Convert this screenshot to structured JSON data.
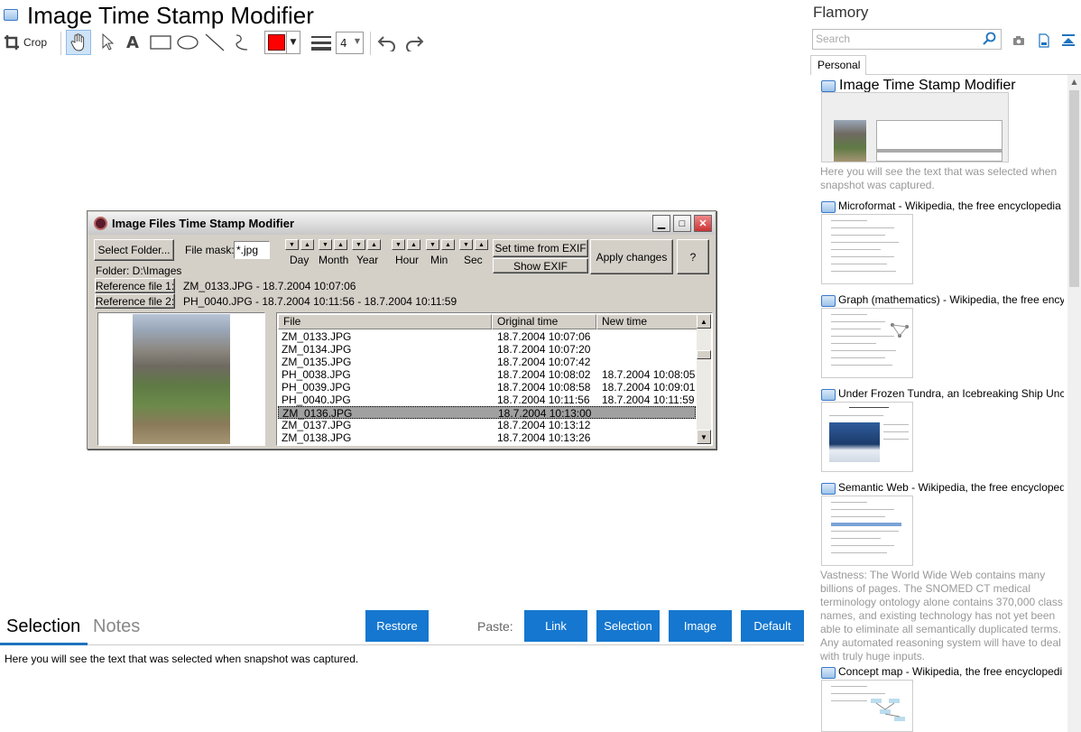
{
  "app": {
    "title": "Image Time Stamp Modifier"
  },
  "toolbar": {
    "crop_label": "Crop",
    "color": "#ff0000",
    "line_width": "4",
    "icons": [
      "crop-icon",
      "hand-icon",
      "pointer-icon",
      "text-icon",
      "rectangle-icon",
      "ellipse-icon",
      "line-icon",
      "freehand-icon",
      "line-width-icon",
      "undo-icon",
      "redo-icon"
    ]
  },
  "snapshot": {
    "window_title": "Image Files Time Stamp Modifier",
    "select_folder": "Select Folder...",
    "file_mask_label": "File mask:",
    "file_mask_value": "*.jpg",
    "spin_labels": [
      "Day",
      "Month",
      "Year",
      "Hour",
      "Min",
      "Sec"
    ],
    "set_time_exif": "Set time from EXIF",
    "show_exif": "Show EXIF",
    "apply_changes": "Apply changes",
    "help": "?",
    "folder": "Folder: D:\\Images",
    "ref1_button": "Reference file 1:",
    "ref1_value": "ZM_0133.JPG - 18.7.2004  10:07:06",
    "ref2_button": "Reference file 2:",
    "ref2_value": "PH_0040.JPG - 18.7.2004  10:11:56 - 18.7.2004  10:11:59",
    "columns": [
      "File",
      "Original time",
      "New time"
    ],
    "rows": [
      {
        "file": "ZM_0133.JPG",
        "original": "18.7.2004  10:07:06",
        "new": ""
      },
      {
        "file": "ZM_0134.JPG",
        "original": "18.7.2004  10:07:20",
        "new": ""
      },
      {
        "file": "ZM_0135.JPG",
        "original": "18.7.2004  10:07:42",
        "new": ""
      },
      {
        "file": "PH_0038.JPG",
        "original": "18.7.2004  10:08:02",
        "new": "18.7.2004  10:08:05"
      },
      {
        "file": "PH_0039.JPG",
        "original": "18.7.2004  10:08:58",
        "new": "18.7.2004  10:09:01"
      },
      {
        "file": "PH_0040.JPG",
        "original": "18.7.2004  10:11:56",
        "new": "18.7.2004  10:11:59"
      },
      {
        "file": "ZM_0136.JPG",
        "original": "18.7.2004  10:13:00",
        "new": ""
      },
      {
        "file": "ZM_0137.JPG",
        "original": "18.7.2004  10:13:12",
        "new": ""
      },
      {
        "file": "ZM_0138.JPG",
        "original": "18.7.2004  10:13:26",
        "new": ""
      }
    ],
    "selected_row": 6
  },
  "bottom": {
    "tab_selection": "Selection",
    "tab_notes": "Notes",
    "restore": "Restore",
    "paste_label": "Paste:",
    "paste_buttons": [
      "Link",
      "Selection",
      "Image",
      "Default"
    ],
    "selection_text": "Here you will see the text that was selected when snapshot was captured.",
    "button_color": "#1577cf"
  },
  "flamory": {
    "title": "Flamory",
    "search_placeholder": "Search",
    "tab": "Personal",
    "cards": [
      {
        "title": "Image Time Stamp Modifier",
        "note": "Here you will see the text that was selected when snapshot was captured."
      },
      {
        "title": "Microformat - Wikipedia, the free encyclopedia",
        "note": ""
      },
      {
        "title": "Graph (mathematics) - Wikipedia, the free ency",
        "note": ""
      },
      {
        "title": "Under Frozen Tundra, an Icebreaking Ship Unco",
        "note": ""
      },
      {
        "title": "Semantic Web - Wikipedia, the free encycloped",
        "note": "Vastness: The World Wide Web contains many billions of pages. The SNOMED CT medical terminology ontology alone contains 370,000 class names, and existing technology has not yet been able to eliminate all semantically duplicated terms. Any automated reasoning system will have to deal with truly huge inputs."
      },
      {
        "title": "Concept map - Wikipedia, the free encyclopedi",
        "note": ""
      }
    ]
  }
}
